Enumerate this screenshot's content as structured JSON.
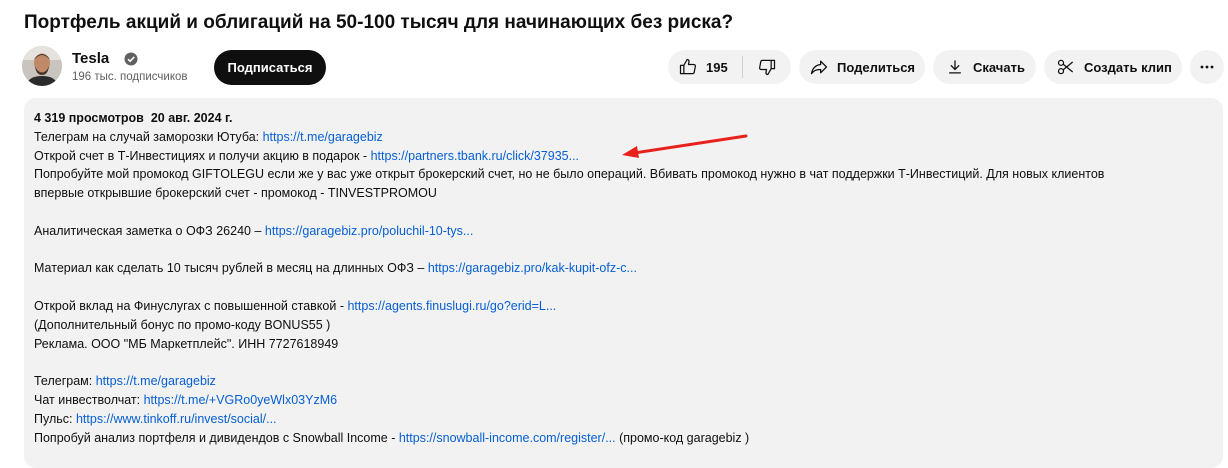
{
  "video": {
    "title": "Портфель акций и облигаций на 50-100 тысяч для начинающих без риска?"
  },
  "channel": {
    "name": "Tesla",
    "subscribers": "196 тыс. подписчиков",
    "avatar_icon": "channel-avatar",
    "subscribe_label": "Подписаться"
  },
  "actions": {
    "likes": "195",
    "share_label": "Поделиться",
    "download_label": "Скачать",
    "clip_label": "Создать клип"
  },
  "description": {
    "views": "4 319 просмотров",
    "date": "20 авг. 2024 г.",
    "lines": [
      {
        "text": "Телеграм на случай заморозки Ютуба: ",
        "link": "https://t.me/garagebiz",
        "after": ""
      },
      {
        "text": "Открой счет в Т-Инвестициях и получи акцию в подарок - ",
        "link": "https://partners.tbank.ru/click/37935...",
        "after": ""
      },
      {
        "text": "Попробуйте мой промокод GIFTOLEGU если же у вас уже открыт брокерский счет, но не было операций. Вбивать промокод нужно в чат поддержки Т-Инвестиций. Для новых клиентов",
        "link": "",
        "after": ""
      },
      {
        "text": "впервые открывшие брокерский счет - промокод - TINVESTPROMOU",
        "link": "",
        "after": ""
      },
      {
        "text": "",
        "link": "",
        "after": ""
      },
      {
        "text": "Аналитическая заметка о ОФЗ 26240 – ",
        "link": "https://garagebiz.pro/poluchil-10-tys...",
        "after": ""
      },
      {
        "text": "",
        "link": "",
        "after": ""
      },
      {
        "text": "Материал как сделать 10 тысяч рублей в месяц на длинных ОФЗ – ",
        "link": "https://garagebiz.pro/kak-kupit-ofz-c...",
        "after": ""
      },
      {
        "text": "",
        "link": "",
        "after": ""
      },
      {
        "text": "Открой вклад на Финуслугах с повышенной ставкой - ",
        "link": "https://agents.finuslugi.ru/go?erid=L...",
        "after": ""
      },
      {
        "text": "(Дополнительный бонус по промо-коду BONUS55 )",
        "link": "",
        "after": ""
      },
      {
        "text": "Реклама. ООО \"МБ Маркетплейс\". ИНН 7727618949",
        "link": "",
        "after": ""
      },
      {
        "text": "",
        "link": "",
        "after": ""
      },
      {
        "text": "Телеграм: ",
        "link": "https://t.me/garagebiz",
        "after": ""
      },
      {
        "text": "Чат инвестволчат: ",
        "link": "https://t.me/+VGRo0yeWlx03YzM6",
        "after": ""
      },
      {
        "text": "Пульс: ",
        "link": "https://www.tinkoff.ru/invest/social/...",
        "after": ""
      },
      {
        "text": "Попробуй анализ портфеля и дивидендов с Snowball Income - ",
        "link": "https://snowball-income.com/register/...",
        "after": " (промо-код garagebiz )"
      }
    ]
  },
  "colors": {
    "link": "#065fd4",
    "arrow": "#e8211d",
    "description_bg": "#f2f2f2"
  }
}
